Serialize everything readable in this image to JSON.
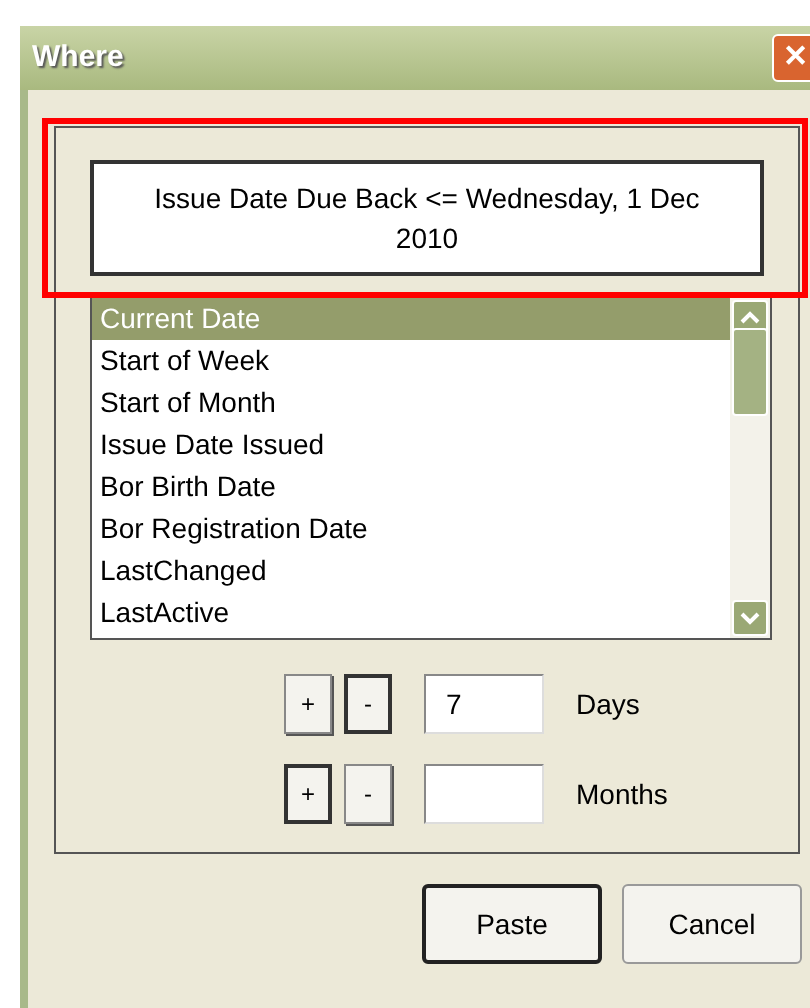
{
  "window": {
    "title": "Where",
    "close": "✕"
  },
  "expression": {
    "text": "Issue Date Due Back <= Wednesday, 1 Dec 2010",
    "highlighted": true
  },
  "list": {
    "items": [
      {
        "label": "Current Date",
        "selected": true
      },
      {
        "label": "Start of Week",
        "selected": false
      },
      {
        "label": "Start of Month",
        "selected": false
      },
      {
        "label": "Issue Date Issued",
        "selected": false
      },
      {
        "label": "Bor Birth Date",
        "selected": false
      },
      {
        "label": "Bor Registration Date",
        "selected": false
      },
      {
        "label": "LastChanged",
        "selected": false
      },
      {
        "label": "LastActive",
        "selected": false
      }
    ]
  },
  "offsets": [
    {
      "plus": {
        "label": "+",
        "pressed": false
      },
      "minus": {
        "label": "-",
        "pressed": true
      },
      "value": "7",
      "unit": "Days"
    },
    {
      "plus": {
        "label": "+",
        "pressed": true
      },
      "minus": {
        "label": "-",
        "pressed": false
      },
      "unit": "Months"
    }
  ],
  "buttons": [
    {
      "label": "Paste",
      "default": true
    },
    {
      "label": "Cancel",
      "default": false
    }
  ]
}
